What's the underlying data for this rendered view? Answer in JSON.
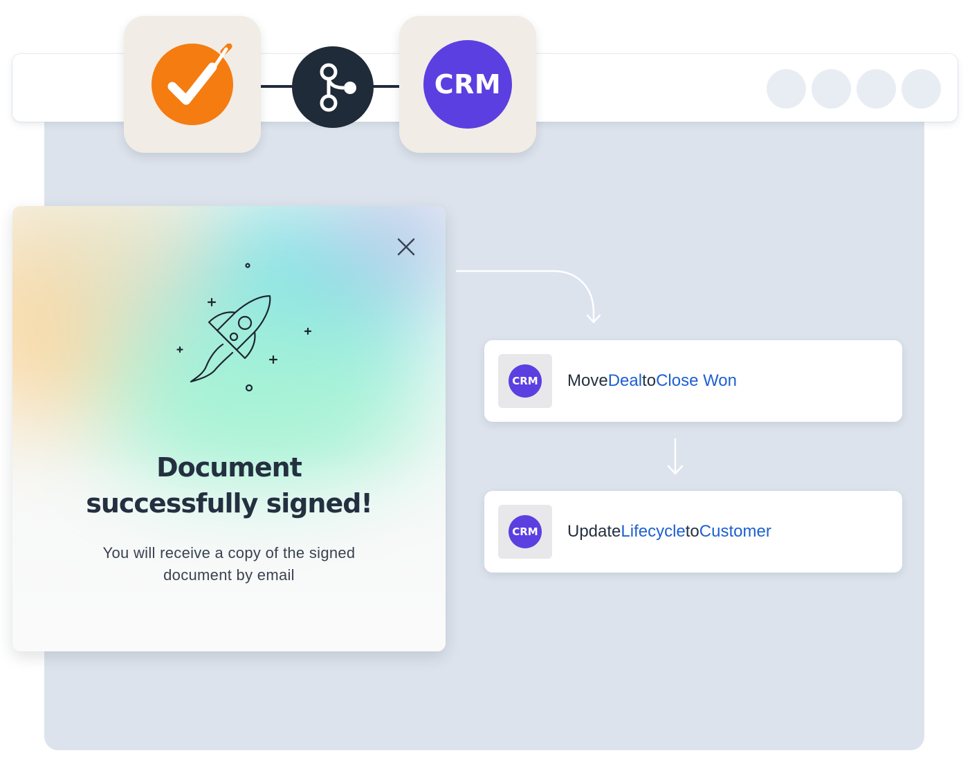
{
  "integration": {
    "source_app_icon": "orange-check-signature-icon",
    "hub_icon": "webhook-branch-icon",
    "target_app_label": "CRM"
  },
  "modal": {
    "close_icon": "close-icon",
    "illustration_icon": "rocket-icon",
    "title_line1": "Document",
    "title_line2": "successfully signed!",
    "subtitle_line1": "You will receive a copy of the signed",
    "subtitle_line2": "document by email"
  },
  "actions": [
    {
      "app_label": "CRM",
      "verb": "Move",
      "object": "Deal",
      "connector": "to",
      "target": "Close Won"
    },
    {
      "app_label": "CRM",
      "verb": "Update",
      "object": "Lifecycle",
      "connector": "to",
      "target": "Customer"
    }
  ],
  "colors": {
    "brand_orange": "#f57c10",
    "crm_purple": "#5b3fe0",
    "hub_dark": "#1f2b38",
    "link_blue": "#1d5fd1",
    "panel_bg": "#dce3ec"
  }
}
